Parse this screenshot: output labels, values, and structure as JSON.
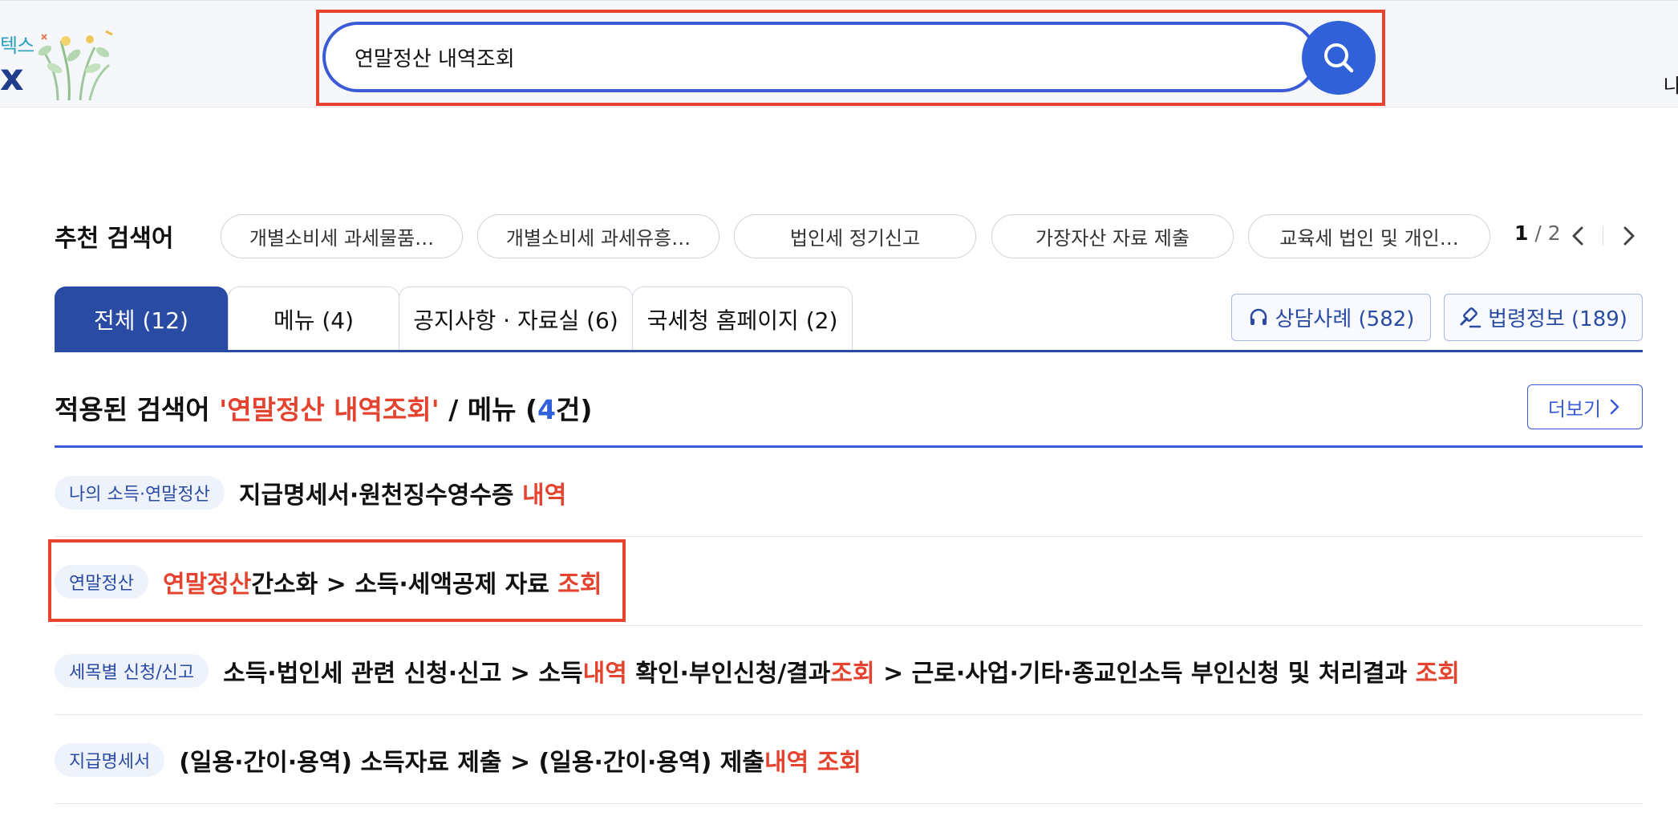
{
  "header": {
    "logo_sub": "텍스",
    "logo_main": "x",
    "search": {
      "value": "연말정산 내역조회"
    },
    "right_partial": "나"
  },
  "recommended": {
    "title": "추천 검색어",
    "chips": [
      "개별소비세 과세물품…",
      "개별소비세 과세유흥…",
      "법인세 정기신고",
      "가장자산 자료 제출",
      "교육세 법인 및 개인…"
    ],
    "pager": {
      "current": "1",
      "separator": " / ",
      "total": "2"
    }
  },
  "tabs": [
    {
      "label": "전체 (12)",
      "active": true
    },
    {
      "label": "메뉴 (4)",
      "active": false
    },
    {
      "label": "공지사항 · 자료실 (6)",
      "active": false
    },
    {
      "label": "국세청 홈페이지 (2)",
      "active": false
    }
  ],
  "right_buttons": {
    "consult": "상담사례 (582)",
    "law": "법령정보 (189)"
  },
  "section": {
    "prefix": "적용된 검색어 ",
    "query": "'연말정산 내역조회'",
    "mid": " / 메뉴 (",
    "count": "4",
    "suffix": "건)",
    "more_label": "더보기"
  },
  "results": [
    {
      "badge": "나의 소득·연말정산",
      "parts": [
        {
          "text": "지급명세서·원천징수영수증 ",
          "hl": false
        },
        {
          "text": "내역",
          "hl": true
        }
      ]
    },
    {
      "badge": "연말정산",
      "parts": [
        {
          "text": "연말정산",
          "hl": true
        },
        {
          "text": "간소화 > 소득·세액공제 자료 ",
          "hl": false
        },
        {
          "text": "조회",
          "hl": true
        }
      ]
    },
    {
      "badge": "세목별 신청/신고",
      "parts": [
        {
          "text": "소득·법인세 관련 신청·신고 > 소득",
          "hl": false
        },
        {
          "text": "내역",
          "hl": true
        },
        {
          "text": " 확인·부인신청/결과",
          "hl": false
        },
        {
          "text": "조회",
          "hl": true
        },
        {
          "text": " > 근로·사업·기타·종교인소득 부인신청 및 처리결과 ",
          "hl": false
        },
        {
          "text": "조회",
          "hl": true
        }
      ]
    },
    {
      "badge": "지급명세서",
      "parts": [
        {
          "text": "(일용·간이·용역) 소득자료 제출 > (일용·간이·용역) 제출",
          "hl": false
        },
        {
          "text": "내역 조회",
          "hl": true
        }
      ]
    }
  ],
  "colors": {
    "primary": "#2a4ba3",
    "accent_blue": "#3161d8",
    "highlight_red": "#e4442f",
    "annotation_red": "#e8432e"
  },
  "icons": {
    "search": "search-icon",
    "prev": "chevron-left-icon",
    "next": "chevron-right-icon",
    "consult": "headset-icon",
    "law": "gavel-icon",
    "more": "chevron-right-icon"
  }
}
